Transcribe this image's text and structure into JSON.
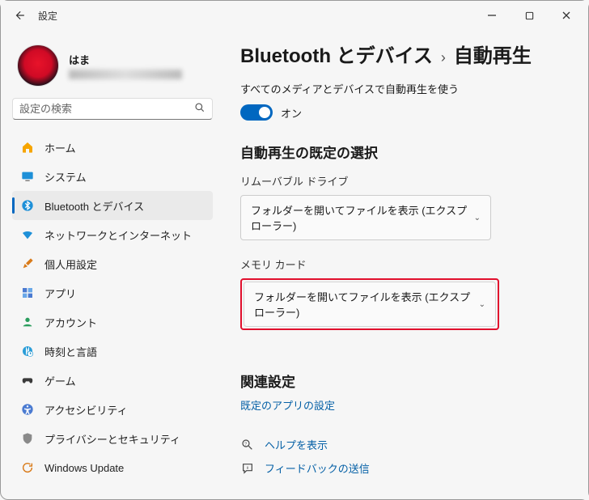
{
  "window": {
    "title": "設定"
  },
  "profile": {
    "name": "はま"
  },
  "search": {
    "placeholder": "設定の検索"
  },
  "sidebar": {
    "items": [
      {
        "label": "ホーム"
      },
      {
        "label": "システム"
      },
      {
        "label": "Bluetooth とデバイス"
      },
      {
        "label": "ネットワークとインターネット"
      },
      {
        "label": "個人用設定"
      },
      {
        "label": "アプリ"
      },
      {
        "label": "アカウント"
      },
      {
        "label": "時刻と言語"
      },
      {
        "label": "ゲーム"
      },
      {
        "label": "アクセシビリティ"
      },
      {
        "label": "プライバシーとセキュリティ"
      },
      {
        "label": "Windows Update"
      }
    ]
  },
  "breadcrumb": {
    "parent": "Bluetooth とデバイス",
    "current": "自動再生"
  },
  "autoplay": {
    "toggle_label": "すべてのメディアとデバイスで自動再生を使う",
    "toggle_state": "オン",
    "section_title": "自動再生の既定の選択",
    "removable": {
      "label": "リムーバブル ドライブ",
      "value": "フォルダーを開いてファイルを表示 (エクスプローラー)"
    },
    "memory_card": {
      "label": "メモリ カード",
      "value": "フォルダーを開いてファイルを表示 (エクスプローラー)"
    }
  },
  "related": {
    "title": "関連設定",
    "default_apps": "既定のアプリの設定",
    "help": "ヘルプを表示",
    "feedback": "フィードバックの送信"
  }
}
